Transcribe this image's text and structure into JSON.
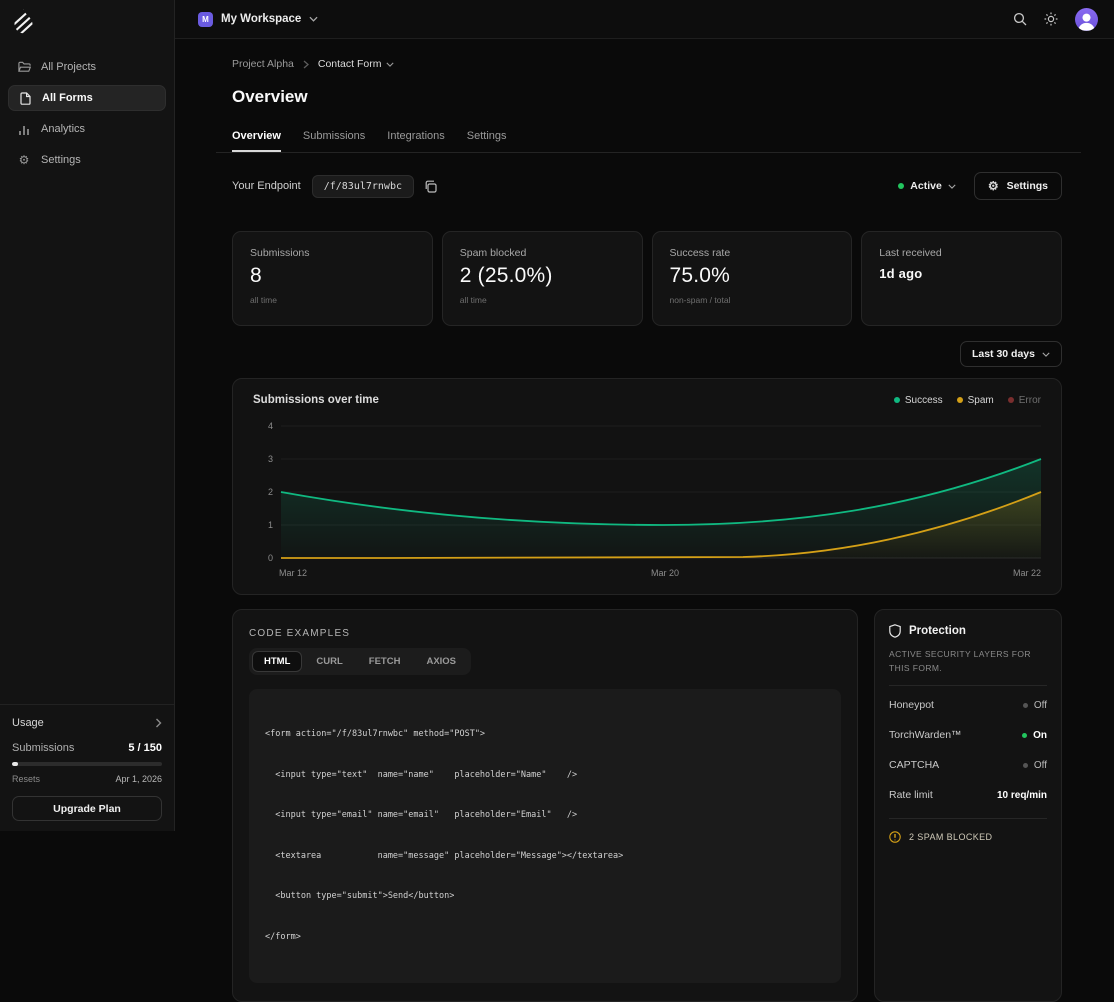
{
  "topbar": {
    "workspace_initial": "M",
    "workspace_name": "My Workspace"
  },
  "sidebar": {
    "items": [
      {
        "label": "All Projects",
        "icon": "folder-icon"
      },
      {
        "label": "All Forms",
        "icon": "file-icon"
      },
      {
        "label": "Analytics",
        "icon": "bar-chart-icon"
      },
      {
        "label": "Settings",
        "icon": "gear-icon"
      }
    ],
    "usage": {
      "title": "Usage",
      "submissions_label": "Submissions",
      "submissions_value": "5 / 150",
      "resets_label": "Resets",
      "resets_value": "Apr 1, 2026",
      "upgrade_label": "Upgrade Plan"
    }
  },
  "breadcrumb": {
    "project": "Project Alpha",
    "form": "Contact Form"
  },
  "page": {
    "title": "Overview",
    "tabs": [
      {
        "label": "Overview"
      },
      {
        "label": "Submissions"
      },
      {
        "label": "Integrations"
      },
      {
        "label": "Settings"
      }
    ]
  },
  "endpoint": {
    "label": "Your Endpoint",
    "path": "/f/83ul7rnwbc",
    "status": "Active",
    "settings_label": "Settings"
  },
  "stats": [
    {
      "label": "Submissions",
      "value": "8",
      "sub": "all time"
    },
    {
      "label": "Spam blocked",
      "value": "2 (25.0%)",
      "sub": "all time"
    },
    {
      "label": "Success rate",
      "value": "75.0%",
      "sub": "non-spam / total"
    },
    {
      "label": "Last received",
      "value": "1d ago",
      "sub": ""
    }
  ],
  "range_selector": {
    "label": "Last 30 days"
  },
  "chart": {
    "title": "Submissions over time",
    "legend": [
      {
        "label": "Success",
        "color": "#10b981"
      },
      {
        "label": "Spam",
        "color": "#d4a017"
      },
      {
        "label": "Error",
        "color": "#7a2e2e"
      }
    ]
  },
  "chart_data": {
    "type": "line",
    "x": [
      "Mar 12",
      "Mar 20",
      "Mar 22"
    ],
    "series": [
      {
        "name": "Success",
        "color": "#10b981",
        "values": [
          2,
          1,
          3
        ]
      },
      {
        "name": "Spam",
        "color": "#d4a017",
        "values": [
          0,
          0,
          2
        ]
      },
      {
        "name": "Error",
        "color": "#7a2e2e",
        "values": [
          0,
          0,
          0
        ]
      }
    ],
    "ylim": [
      0,
      4
    ],
    "yticks_display": [
      "4",
      "3",
      "2",
      "1",
      "0"
    ],
    "xticks": [
      "Mar 12",
      "Mar 20",
      "Mar 22"
    ],
    "grid": true,
    "legend_position": "top-right"
  },
  "code_examples": {
    "heading": "CODE EXAMPLES",
    "tabs": [
      {
        "label": "HTML"
      },
      {
        "label": "CURL"
      },
      {
        "label": "FETCH"
      },
      {
        "label": "AXIOS"
      }
    ],
    "lines": [
      "<form action=\"/f/83ul7rnwbc\" method=\"POST\">",
      "  <input type=\"text\"  name=\"name\"    placeholder=\"Name\"    />",
      "  <input type=\"email\" name=\"email\"   placeholder=\"Email\"   />",
      "  <textarea           name=\"message\" placeholder=\"Message\"></textarea>",
      "  <button type=\"submit\">Send</button>",
      "</form>"
    ]
  },
  "protection": {
    "title": "Protection",
    "subtitle": "ACTIVE SECURITY LAYERS FOR THIS FORM.",
    "rows": [
      {
        "label": "Honeypot",
        "value": "Off",
        "state": "off"
      },
      {
        "label": "TorchWarden™",
        "value": "On",
        "state": "on"
      },
      {
        "label": "CAPTCHA",
        "value": "Off",
        "state": "off"
      },
      {
        "label": "Rate limit",
        "value": "10 req/min",
        "state": "plain"
      }
    ],
    "footer": "2 SPAM BLOCKED"
  }
}
